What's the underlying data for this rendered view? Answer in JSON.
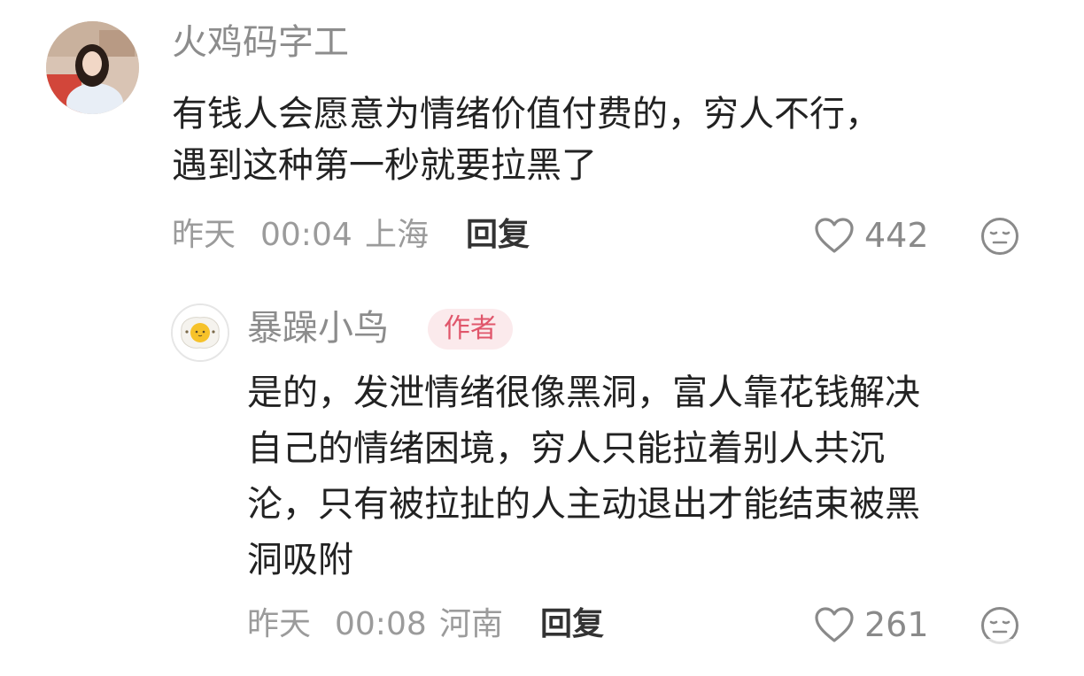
{
  "comment": {
    "username": "火鸡码字工",
    "text_line1": "有钱人会愿意为情绪价值付费的，穷人不行，",
    "text_line2": "遇到这种第一秒就要拉黑了",
    "date": "昨天",
    "time": "00:04",
    "location": "上海",
    "reply_label": "回复",
    "likes": "442"
  },
  "reply": {
    "username": "暴躁小鸟",
    "badge": "作者",
    "text_line1": "是的，发泄情绪很像黑洞，富人靠花钱解决",
    "text_line2": "自己的情绪困境，穷人只能拉着别人共沉",
    "text_line3": "沦，只有被拉扯的人主动退出才能结束被黑",
    "text_line4": "洞吸附",
    "date": "昨天",
    "time": "00:08",
    "location": "河南",
    "reply_label": "回复",
    "likes": "261"
  },
  "icons": {
    "like": "heart-outline-icon",
    "dislike": "neutral-face-icon"
  },
  "colors": {
    "author_badge_bg": "#fbeaec",
    "author_badge_text": "#e0566b",
    "meta_text": "#9b9b9b"
  }
}
